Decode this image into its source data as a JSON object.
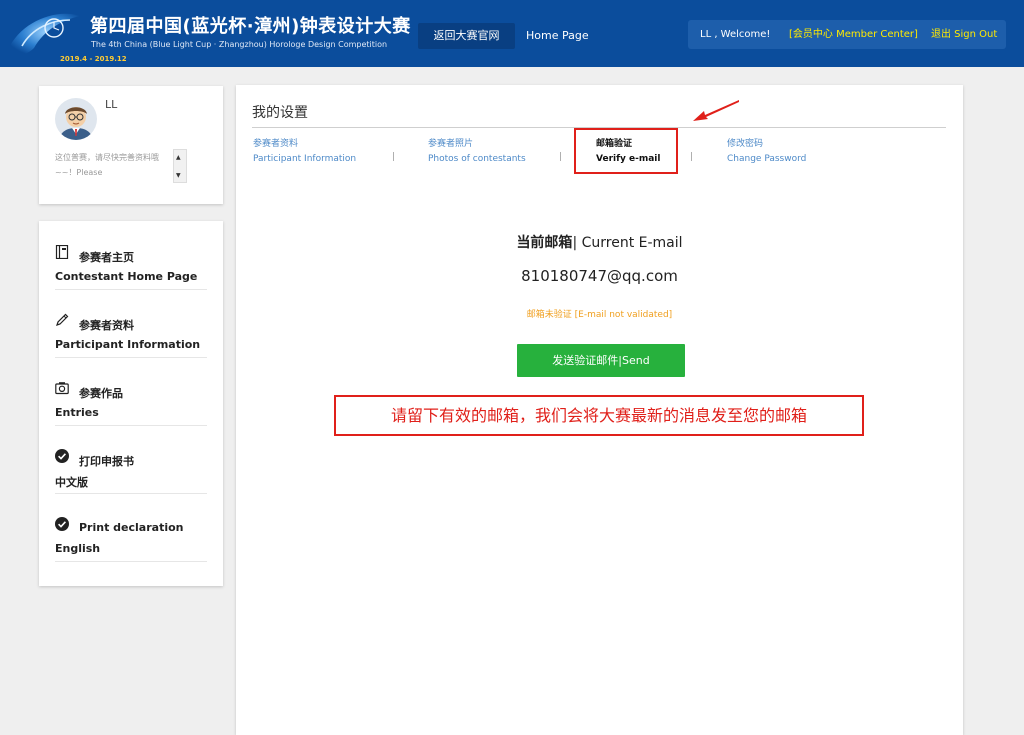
{
  "header": {
    "title_cn": "第四届中国(蓝光杯·漳州)钟表设计大赛",
    "title_en": "The 4th China (Blue Light Cup · Zhangzhou) Horologe Design Competition",
    "date_range": "2019.4 - 2019.12",
    "nav_back": "返回大赛官网",
    "nav_home": "Home Page",
    "welcome": "LL , Welcome!",
    "member_center": "[会员中心 Member Center]",
    "sign_out": "退出 Sign Out"
  },
  "profile": {
    "name": "LL",
    "description": "这位普赛，请尽快完善资料哦~~！Please"
  },
  "sidebar": {
    "items": [
      {
        "label_cn": "参赛者主页",
        "label_en": "Contestant Home Page",
        "icon": "book-icon"
      },
      {
        "label_cn": "参赛者资料",
        "label_en": "Participant Information",
        "icon": "pencil-icon"
      },
      {
        "label_cn": "参赛作品",
        "label_en": "Entries",
        "icon": "camera-icon"
      },
      {
        "label_cn": "打印申报书",
        "label_en": "中文版",
        "icon": "check-circle-icon"
      },
      {
        "label_cn": "Print declaration",
        "label_en": "English",
        "icon": "check-circle-icon"
      }
    ]
  },
  "main": {
    "title": "我的设置",
    "tabs": [
      {
        "label_cn": "参赛者资料",
        "label_en": "Participant Information",
        "active": false
      },
      {
        "label_cn": "参赛者照片",
        "label_en": "Photos of contestants",
        "active": false
      },
      {
        "label_cn": "邮箱验证",
        "label_en": "Verify e-mail",
        "active": true
      },
      {
        "label_cn": "修改密码",
        "label_en": "Change Password",
        "active": false
      }
    ],
    "separator": "|",
    "email_label_cn": "当前邮箱",
    "email_label_sep": "|",
    "email_label_en": "Current E-mail",
    "email_value": "810180747@qq.com",
    "email_status": "邮箱未验证 [E-mail not validated]",
    "send_button": "发送验证邮件|Send",
    "notice": "请留下有效的邮箱，我们会将大赛最新的消息发至您的邮箱"
  },
  "colors": {
    "header_bg": "#0b4d9c",
    "accent_yellow": "#ffea00",
    "link_blue": "#4e8ac8",
    "send_green": "#27b13d",
    "alert_red": "#e0201a",
    "status_orange": "#f0a020"
  }
}
